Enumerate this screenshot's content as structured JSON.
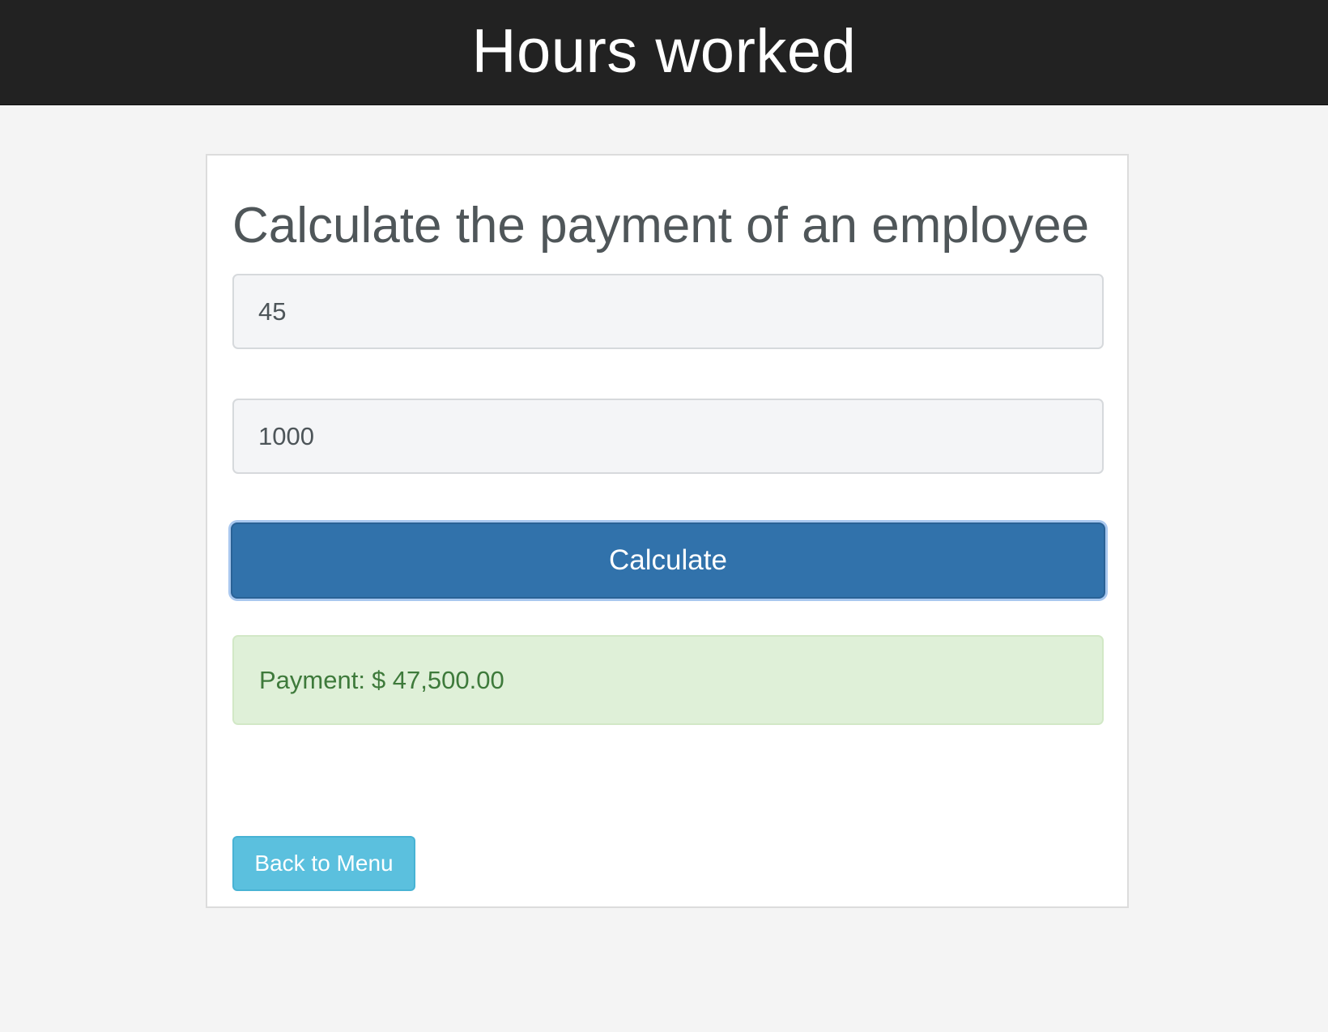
{
  "header": {
    "title": "Hours worked"
  },
  "form": {
    "title": "Calculate the payment of an employee",
    "hours_value": "45",
    "rate_value": "1000",
    "calculate_label": "Calculate",
    "result_label": "Payment:",
    "result_value": "$ 47,500.00",
    "back_label": "Back to Menu"
  },
  "colors": {
    "header_bg": "#222222",
    "primary": "#3172ab",
    "success_bg": "#dff0d8",
    "success_text": "#3e7a3b",
    "info": "#5bc0de"
  }
}
